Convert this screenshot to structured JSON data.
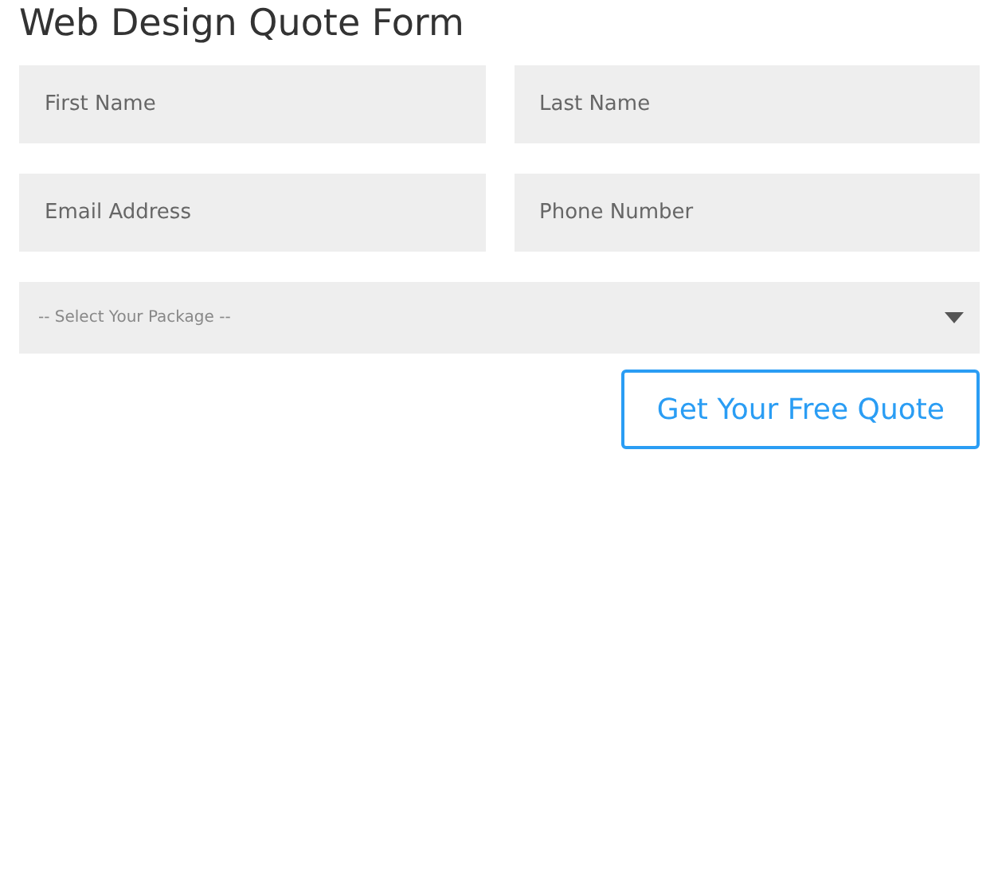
{
  "title": "Web Design Quote Form",
  "rows": [
    [
      {
        "placeholder": "First Name"
      },
      {
        "placeholder": "Last Name"
      }
    ],
    [
      {
        "placeholder": "Email Address"
      },
      {
        "placeholder": "Phone Number"
      }
    ]
  ],
  "package_select": {
    "placeholder": "-- Select Your Package --"
  },
  "submit_button": "Get Your Free Quote"
}
